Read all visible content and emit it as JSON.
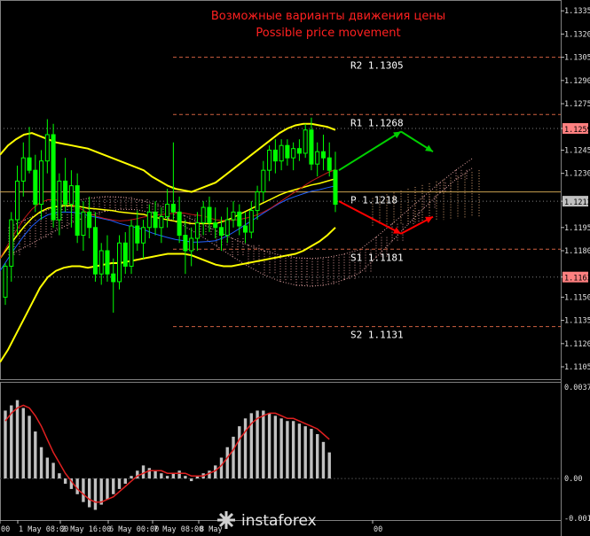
{
  "chart_data": {
    "type": "line",
    "title": "Возможные варианты движения цены",
    "subtitle": "Possible price movement",
    "watermark": "instaforex",
    "colors": {
      "background": "#000000",
      "candle": "#00ff00",
      "bollinger": "#ffff00",
      "pivot": "#f0c060",
      "title": "#ff2020",
      "arrow_up": "#00d000",
      "arrow_down": "#ff0000",
      "macd_bars": "#c0c0c0",
      "macd_signal": "#e02020"
    },
    "price_axis": {
      "range": [
        1.1097,
        1.1342
      ],
      "ticks": [
        "1.1335",
        "1.1320",
        "1.1305",
        "1.1290",
        "1.1275",
        "1.1259",
        "1.1245",
        "1.1230",
        "1.1212",
        "1.1195",
        "1.1180",
        "1.1163",
        "1.1150",
        "1.1135",
        "1.1120",
        "1.1105"
      ],
      "highlighted": [
        {
          "label": "1.1259",
          "value": 1.1259,
          "color": "#ff8080"
        },
        {
          "label": "1.1212",
          "value": 1.1212,
          "color": "#c0c0c0"
        },
        {
          "label": "1.1163",
          "value": 1.1163,
          "color": "#ff8080"
        }
      ]
    },
    "time_axis": {
      "ticks": [
        "00",
        "1 May 08:00",
        "2 May 16:00",
        "6 May 00:00",
        "7 May 08:00",
        "8 May",
        "00"
      ]
    },
    "pivot_levels": [
      {
        "label": "R2",
        "value": "1.1305",
        "level": 1.1305
      },
      {
        "label": "R1",
        "value": "1.1268",
        "level": 1.1268
      },
      {
        "label": "P",
        "value": "1.1218",
        "level": 1.1218
      },
      {
        "label": "S1",
        "value": "1.1181",
        "level": 1.1181
      },
      {
        "label": "S2",
        "value": "1.1131",
        "level": 1.1131
      }
    ],
    "candles": [
      [
        1.115,
        1.1172,
        1.1145,
        1.117
      ],
      [
        1.117,
        1.1205,
        1.116,
        1.12
      ],
      [
        1.12,
        1.1235,
        1.119,
        1.1225
      ],
      [
        1.1225,
        1.125,
        1.1215,
        1.124
      ],
      [
        1.124,
        1.126,
        1.123,
        1.1232
      ],
      [
        1.1232,
        1.1242,
        1.1205,
        1.121
      ],
      [
        1.121,
        1.1245,
        1.12,
        1.1238
      ],
      [
        1.1238,
        1.1265,
        1.123,
        1.1255
      ],
      [
        1.1255,
        1.1262,
        1.1195,
        1.12
      ],
      [
        1.12,
        1.123,
        1.119,
        1.1225
      ],
      [
        1.1225,
        1.124,
        1.1205,
        1.121
      ],
      [
        1.121,
        1.1232,
        1.1195,
        1.1222
      ],
      [
        1.1222,
        1.123,
        1.1185,
        1.119
      ],
      [
        1.119,
        1.1212,
        1.118,
        1.1205
      ],
      [
        1.1205,
        1.1215,
        1.1188,
        1.1195
      ],
      [
        1.1195,
        1.1205,
        1.116,
        1.1165
      ],
      [
        1.1165,
        1.1185,
        1.1158,
        1.118
      ],
      [
        1.118,
        1.119,
        1.116,
        1.1165
      ],
      [
        1.1165,
        1.1175,
        1.114,
        1.116
      ],
      [
        1.116,
        1.119,
        1.1155,
        1.1185
      ],
      [
        1.1185,
        1.1192,
        1.1165,
        1.117
      ],
      [
        1.117,
        1.12,
        1.1165,
        1.1196
      ],
      [
        1.1196,
        1.1206,
        1.118,
        1.1185
      ],
      [
        1.1185,
        1.12,
        1.1175,
        1.1195
      ],
      [
        1.1195,
        1.121,
        1.1188,
        1.1205
      ],
      [
        1.1205,
        1.1212,
        1.119,
        1.1195
      ],
      [
        1.1195,
        1.1208,
        1.1185,
        1.1202
      ],
      [
        1.1202,
        1.122,
        1.1195,
        1.121
      ],
      [
        1.121,
        1.125,
        1.12,
        1.1205
      ],
      [
        1.1205,
        1.1215,
        1.1185,
        1.119
      ],
      [
        1.119,
        1.12,
        1.1165,
        1.118
      ],
      [
        1.118,
        1.1195,
        1.117,
        1.1188
      ],
      [
        1.1188,
        1.1205,
        1.118,
        1.1198
      ],
      [
        1.1198,
        1.1212,
        1.119,
        1.1208
      ],
      [
        1.1208,
        1.1215,
        1.1192,
        1.1198
      ],
      [
        1.1198,
        1.1208,
        1.1188,
        1.1195
      ],
      [
        1.1195,
        1.1202,
        1.118,
        1.119
      ],
      [
        1.119,
        1.1208,
        1.1185,
        1.12
      ],
      [
        1.12,
        1.1212,
        1.1195,
        1.1205
      ],
      [
        1.1205,
        1.121,
        1.119,
        1.1196
      ],
      [
        1.1196,
        1.1205,
        1.1185,
        1.1192
      ],
      [
        1.1192,
        1.1212,
        1.1188,
        1.1206
      ],
      [
        1.1206,
        1.1222,
        1.12,
        1.1218
      ],
      [
        1.1218,
        1.1238,
        1.1212,
        1.1232
      ],
      [
        1.1232,
        1.1248,
        1.1225,
        1.1245
      ],
      [
        1.1245,
        1.1252,
        1.123,
        1.1238
      ],
      [
        1.1238,
        1.1252,
        1.1232,
        1.1248
      ],
      [
        1.1248,
        1.1252,
        1.1235,
        1.124
      ],
      [
        1.124,
        1.125,
        1.1232,
        1.1246
      ],
      [
        1.1246,
        1.1252,
        1.1238,
        1.1243
      ],
      [
        1.1243,
        1.1262,
        1.124,
        1.1258
      ],
      [
        1.1258,
        1.1266,
        1.1232,
        1.1236
      ],
      [
        1.1236,
        1.125,
        1.1228,
        1.1244
      ],
      [
        1.1244,
        1.1255,
        1.1232,
        1.124
      ],
      [
        1.124,
        1.125,
        1.1228,
        1.1232
      ],
      [
        1.1232,
        1.1244,
        1.1205,
        1.121
      ]
    ],
    "bollinger_upper": [
      1.1242,
      1.1248,
      1.1252,
      1.1255,
      1.1256,
      1.1254,
      1.1252,
      1.125,
      1.1249,
      1.1248,
      1.1247,
      1.1246,
      1.1244,
      1.1242,
      1.124,
      1.1238,
      1.1236,
      1.1234,
      1.1232,
      1.1228,
      1.1225,
      1.1222,
      1.122,
      1.1219,
      1.1218,
      1.122,
      1.1222,
      1.1224,
      1.1228,
      1.1232,
      1.1236,
      1.124,
      1.1244,
      1.1248,
      1.1252,
      1.1256,
      1.1259,
      1.1261,
      1.1262,
      1.1262,
      1.1261,
      1.126,
      1.1258
    ],
    "bollinger_lower": [
      1.1108,
      1.1116,
      1.1126,
      1.1136,
      1.1146,
      1.1156,
      1.1163,
      1.1167,
      1.1169,
      1.117,
      1.117,
      1.1169,
      1.117,
      1.1171,
      1.1172,
      1.1172,
      1.1173,
      1.1174,
      1.1175,
      1.1176,
      1.1177,
      1.1178,
      1.1178,
      1.1178,
      1.1177,
      1.1175,
      1.1173,
      1.1171,
      1.117,
      1.117,
      1.1171,
      1.1172,
      1.1173,
      1.1174,
      1.1175,
      1.1176,
      1.1177,
      1.1178,
      1.118,
      1.1183,
      1.1186,
      1.119,
      1.1195
    ],
    "scenario_arrows": [
      {
        "name": "bullish",
        "color": "#00d000",
        "path": [
          [
            0,
            1.1232
          ],
          [
            1,
            1.1257
          ],
          [
            2,
            1.1244
          ]
        ]
      },
      {
        "name": "bearish",
        "color": "#ff0000",
        "path": [
          [
            0,
            1.1212
          ],
          [
            1,
            1.1191
          ],
          [
            2,
            1.1202
          ]
        ]
      }
    ],
    "macd": {
      "range": [
        -0.00159,
        0.0037
      ],
      "ticks": [
        "0.0037",
        "0.00",
        "-0.00159"
      ],
      "histogram": [
        0.0026,
        0.0028,
        0.003,
        0.0027,
        0.0024,
        0.0018,
        0.0012,
        0.0008,
        0.0006,
        0.0002,
        -0.0002,
        -0.0004,
        -0.0006,
        -0.0009,
        -0.0011,
        -0.0012,
        -0.001,
        -0.0008,
        -0.0006,
        -0.0004,
        -0.0002,
        0.0001,
        0.0003,
        0.0005,
        0.0004,
        0.0003,
        0.0002,
        0.0001,
        0.0002,
        0.0003,
        0.0001,
        -0.0001,
        0.0001,
        0.0002,
        0.0003,
        0.0005,
        0.0008,
        0.0012,
        0.0016,
        0.002,
        0.0023,
        0.0025,
        0.0026,
        0.0026,
        0.0025,
        0.0024,
        0.0023,
        0.0022,
        0.0022,
        0.0021,
        0.002,
        0.0019,
        0.0017,
        0.0014,
        0.001
      ],
      "signal": [
        0.0022,
        0.0025,
        0.0027,
        0.0028,
        0.0027,
        0.0024,
        0.002,
        0.0015,
        0.001,
        0.0006,
        0.0002,
        -0.0001,
        -0.0004,
        -0.0006,
        -0.0008,
        -0.0009,
        -0.0009,
        -0.0008,
        -0.0007,
        -0.0005,
        -0.0003,
        -0.0001,
        0.0001,
        0.0002,
        0.0003,
        0.0003,
        0.0003,
        0.0002,
        0.0002,
        0.0002,
        0.0002,
        0.0001,
        0.0001,
        0.0001,
        0.0002,
        0.0003,
        0.0005,
        0.0008,
        0.0011,
        0.0015,
        0.0018,
        0.0021,
        0.0023,
        0.0024,
        0.0025,
        0.0025,
        0.0024,
        0.0023,
        0.0023,
        0.0022,
        0.0021,
        0.002,
        0.0019,
        0.0017,
        0.0015
      ]
    }
  }
}
